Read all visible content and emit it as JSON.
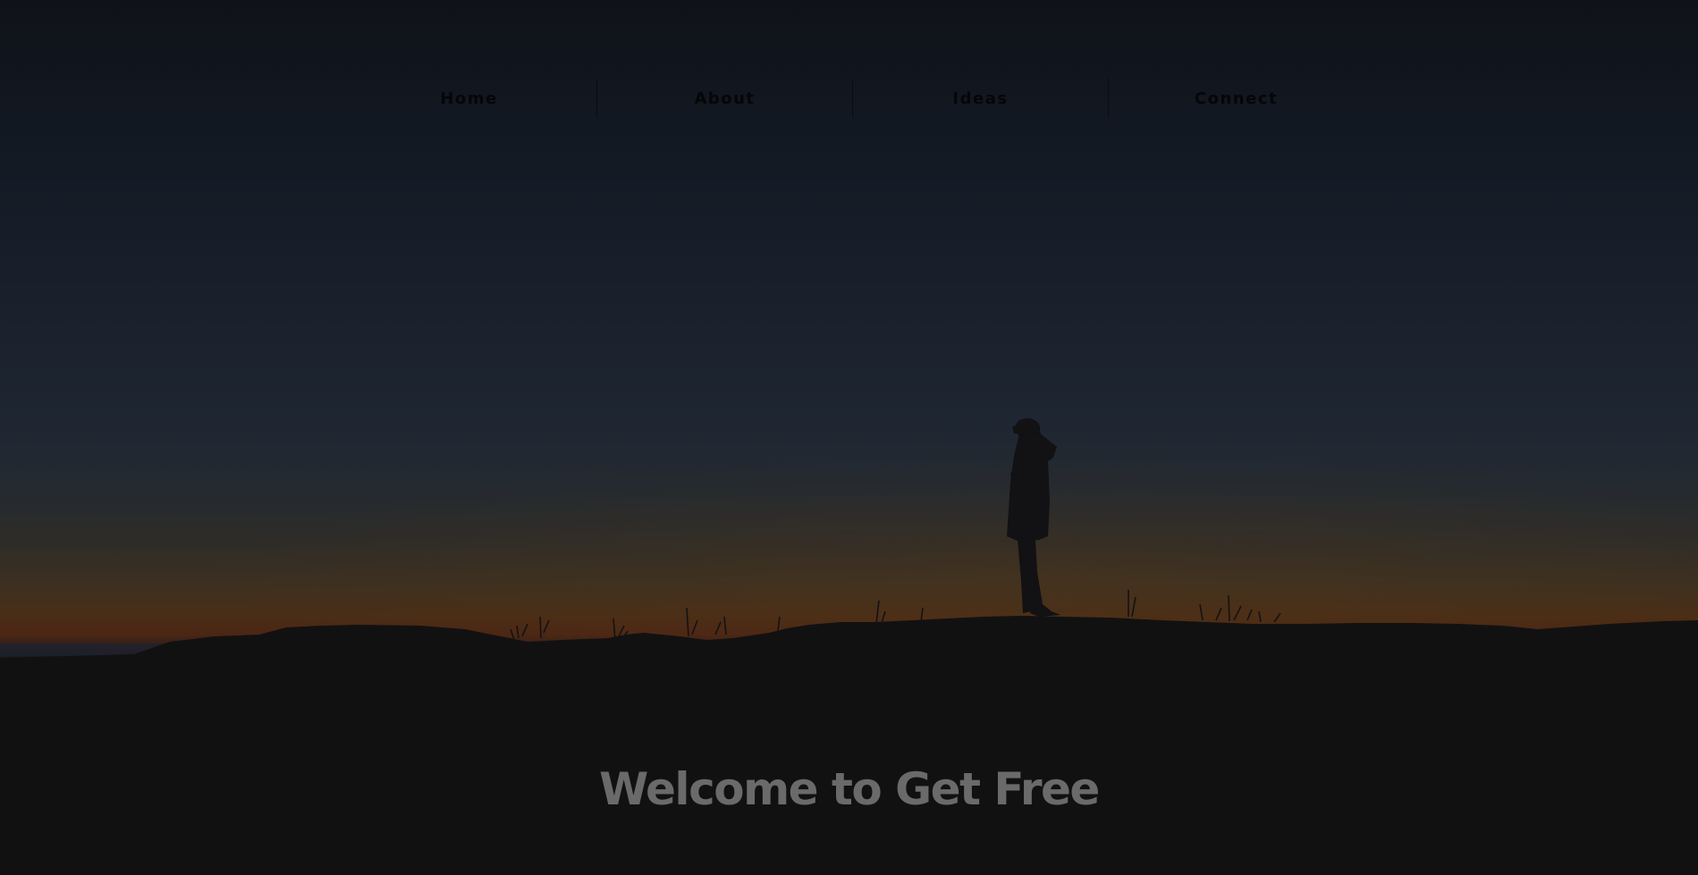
{
  "nav": {
    "items": [
      {
        "label": "Home"
      },
      {
        "label": "About"
      },
      {
        "label": "Ideas"
      },
      {
        "label": "Connect"
      }
    ]
  },
  "hero": {
    "heading": "Welcome to Get Free"
  },
  "colors": {
    "sky_top": "#10141c",
    "sky_mid": "#1c2431",
    "horizon_amber": "#4a2d14",
    "ground": "#121214",
    "heading_text": "#6a6a6a",
    "nav_text": "#050608"
  }
}
